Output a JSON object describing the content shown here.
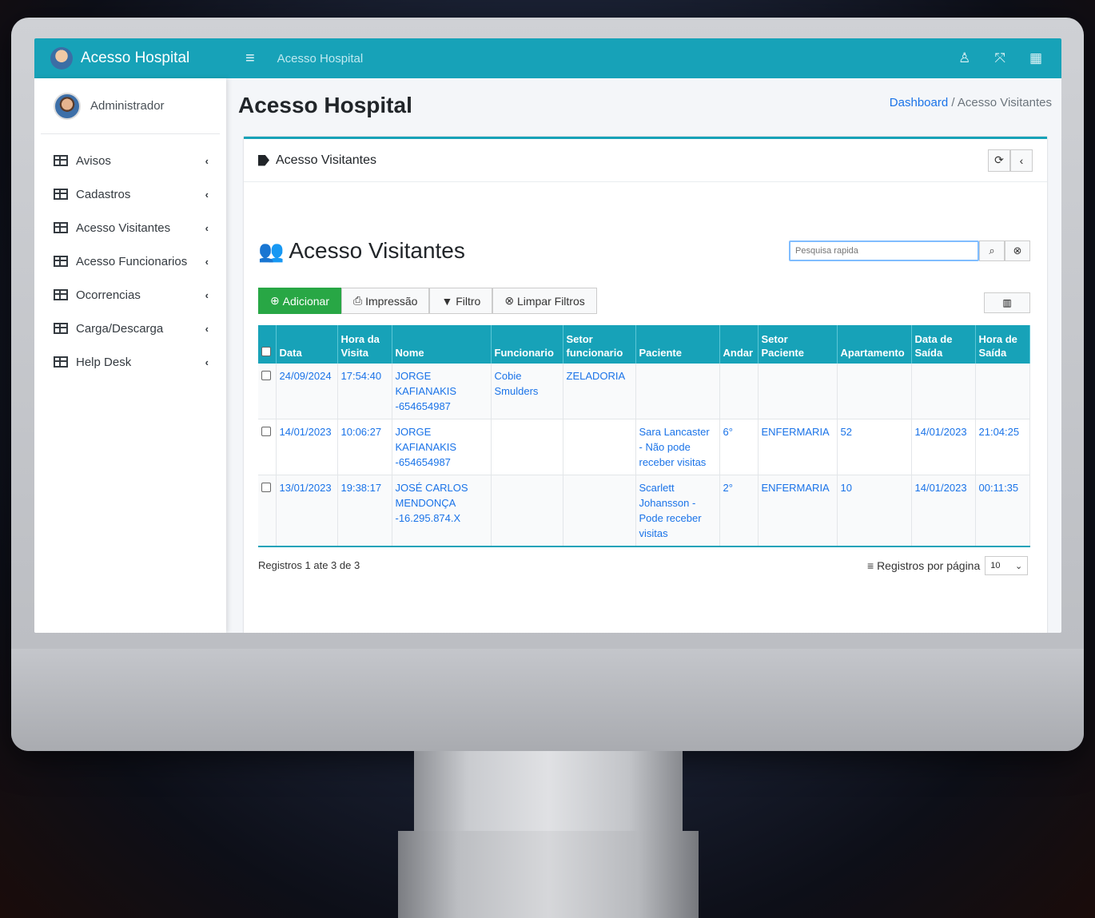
{
  "brand": {
    "title": "Acesso Hospital"
  },
  "topbar": {
    "title": "Acesso Hospital",
    "menu_icon": "≡",
    "user_icon": "♙",
    "expand_icon": "⤧",
    "apps_icon": "▦"
  },
  "sidebar": {
    "user": "Administrador",
    "items": [
      {
        "label": "Avisos"
      },
      {
        "label": "Cadastros"
      },
      {
        "label": "Acesso Visitantes"
      },
      {
        "label": "Acesso Funcionarios"
      },
      {
        "label": "Ocorrencias"
      },
      {
        "label": "Carga/Descarga"
      },
      {
        "label": "Help Desk"
      }
    ]
  },
  "page": {
    "title": "Acesso Hospital",
    "breadcrumb": {
      "home": "Dashboard",
      "sep": "/",
      "current": "Acesso Visitantes"
    }
  },
  "card": {
    "title": "Acesso Visitantes",
    "section_title": "Acesso Visitantes",
    "search_placeholder": "Pesquisa rapida",
    "buttons": {
      "add": "Adicionar",
      "print": "Impressão",
      "filter": "Filtro",
      "clear": "Limpar Filtros"
    }
  },
  "table": {
    "headers": [
      "Data",
      "Hora da Visita",
      "Nome",
      "Funcionario",
      "Setor funcionario",
      "Paciente",
      "Andar",
      "Setor Paciente",
      "Apartamento",
      "Data de Saída",
      "Hora de Saída"
    ],
    "rows": [
      [
        "24/09/2024",
        "17:54:40",
        "JORGE KAFIANAKIS -654654987",
        "Cobie Smulders",
        "ZELADORIA",
        "",
        "",
        "",
        "",
        "",
        ""
      ],
      [
        "14/01/2023",
        "10:06:27",
        "JORGE KAFIANAKIS -654654987",
        "",
        "",
        "Sara Lancaster - Não pode receber visitas",
        "6°",
        "ENFERMARIA",
        "52",
        "14/01/2023",
        "21:04:25"
      ],
      [
        "13/01/2023",
        "19:38:17",
        "JOSÉ CARLOS MENDONÇA -16.295.874.X",
        "",
        "",
        "Scarlett Johansson - Pode receber visitas",
        "2°",
        "ENFERMARIA",
        "10",
        "14/01/2023",
        "00:11:35"
      ]
    ]
  },
  "footer": {
    "records": "Registros 1 ate 3 de 3",
    "per_page_label": "Registros por página",
    "per_page_value": "10"
  },
  "colors": {
    "accent": "#17a2b8",
    "add": "#28a745",
    "link": "#1a73e8"
  }
}
